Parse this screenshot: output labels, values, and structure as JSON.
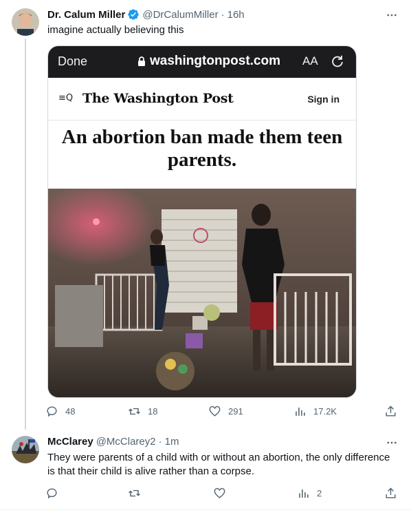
{
  "tweet_main": {
    "author_name": "Dr. Calum Miller",
    "handle": "@DrCalumMiller",
    "time": "16h",
    "text": "imagine actually believing this",
    "media": {
      "browser_done": "Done",
      "browser_url": "washingtonpost.com",
      "browser_text_size": "AA",
      "site_menu_icon": "≡Q",
      "site_logo": "The Washington Post",
      "site_sign_in": "Sign in",
      "headline": "An abortion ban made them teen parents."
    },
    "replies": "48",
    "retweets": "18",
    "likes": "291",
    "views": "17.2K"
  },
  "tweet_reply": {
    "author_name": "McClarey",
    "handle": "@McClarey2",
    "time": "1m",
    "text": "They were parents of a child with or without an abortion, the only difference is that their child is alive rather than a corpse.",
    "replies": "",
    "retweets": "",
    "likes": "",
    "views": "2"
  },
  "separator": "·",
  "icons": {
    "verified": "verified-badge-icon",
    "more": "more-icon",
    "reply": "reply-icon",
    "retweet": "retweet-icon",
    "like": "heart-icon",
    "views": "views-icon",
    "share": "share-icon"
  },
  "colors": {
    "text": "#0f1419",
    "muted": "#536471",
    "verified": "#1d9bf0",
    "thread_line": "#cfd9de"
  }
}
